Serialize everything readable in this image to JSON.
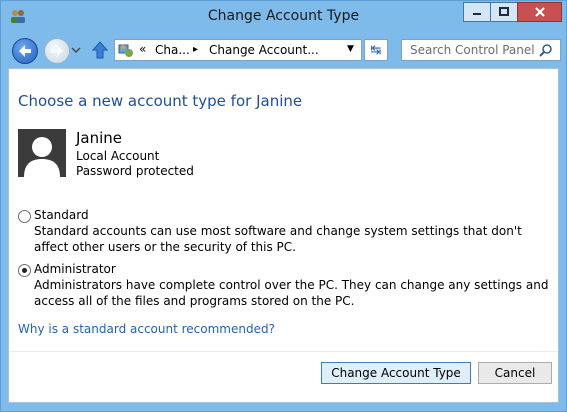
{
  "window": {
    "title": "Change Account Type"
  },
  "nav": {
    "breadcrumb_overflow": "«",
    "crumb1": "Cha...",
    "crumb2": "Change Account...",
    "search_placeholder": "Search Control Panel"
  },
  "main": {
    "heading": "Choose a new account type for Janine",
    "account": {
      "name": "Janine",
      "type": "Local Account",
      "status": "Password protected"
    },
    "options": [
      {
        "label": "Standard",
        "checked": false,
        "desc": "Standard accounts can use most software and change system settings that don't affect other users or the security of this PC."
      },
      {
        "label": "Administrator",
        "checked": true,
        "desc": "Administrators have complete control over the PC. They can change any settings and access all of the files and programs stored on the PC."
      }
    ],
    "help_link": "Why is a standard account recommended?"
  },
  "buttons": {
    "primary": "Change Account Type",
    "cancel": "Cancel"
  },
  "colors": {
    "frame": "#7fbbea",
    "heading": "#1e4e9a",
    "link": "#2063b6",
    "close": "#c75050"
  }
}
